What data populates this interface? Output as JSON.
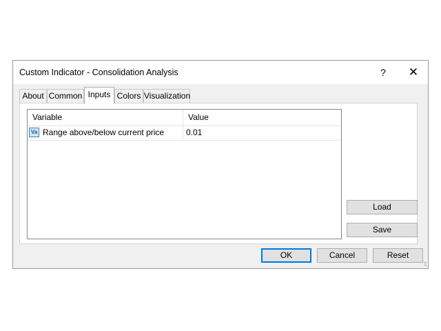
{
  "dialog": {
    "title": "Custom Indicator - Consolidation Analysis",
    "help_label": "?",
    "close_label": "✕"
  },
  "tabs": [
    {
      "label": "About"
    },
    {
      "label": "Common"
    },
    {
      "label": "Inputs",
      "active": true
    },
    {
      "label": "Colors"
    },
    {
      "label": "Visualization"
    }
  ],
  "inputs_table": {
    "headers": {
      "variable": "Variable",
      "value": "Value"
    },
    "rows": [
      {
        "icon": "variable-icon",
        "icon_text": "Va",
        "variable": "Range above/below current price",
        "value": "0.01"
      }
    ]
  },
  "side_buttons": {
    "load": "Load",
    "save": "Save"
  },
  "footer_buttons": {
    "ok": "OK",
    "cancel": "Cancel",
    "reset": "Reset"
  },
  "colors": {
    "accent": "#0078d7",
    "dialog_bg": "#f0f0f0",
    "button_bg": "#e1e1e1"
  }
}
